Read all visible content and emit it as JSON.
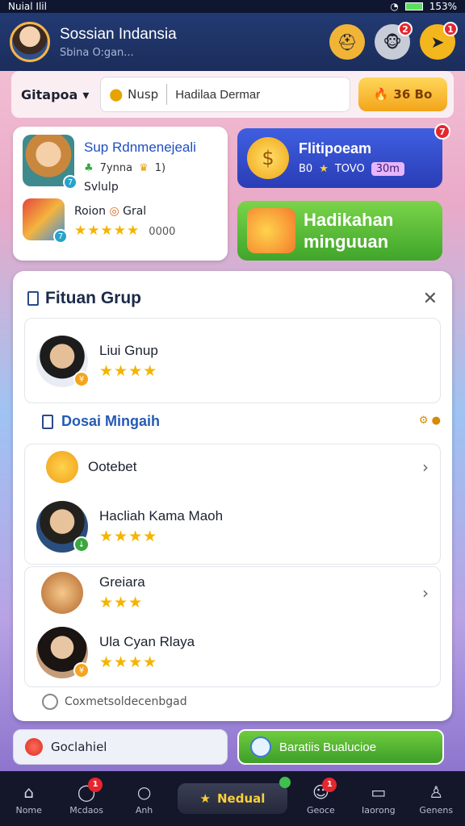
{
  "status": {
    "left": "Nuial Ilil",
    "right": "153%"
  },
  "header": {
    "title": "Sossian Indansia",
    "subtitle": "Sbina O:gan...",
    "badges": [
      "2",
      "1"
    ]
  },
  "search": {
    "dropdown_label": "Gitapoa",
    "prefix": "Nusp",
    "value": "Hadilaa Dermar",
    "coins": "36 Bo"
  },
  "profile_card": {
    "name": "Sup Rdnmenejeali",
    "stat_a": "7ynna",
    "stat_b": "1)",
    "label": "Svlulp",
    "sub_label": "Roion",
    "sub_value": "Gral",
    "rating": "0000",
    "stars": "★★★★★"
  },
  "promo": {
    "title": "Flitipoeam",
    "meta_a": "B0",
    "meta_b": "TOVO",
    "meta_c": "30m",
    "badge": "7"
  },
  "reward": {
    "line1": "Hadikahan",
    "line2": "minguuan"
  },
  "panel": {
    "title": "Fituan Grup",
    "top_member": {
      "name": "Liui Gnup",
      "stars": "★★★★"
    },
    "section_title": "Dosai Mingaih",
    "list": [
      {
        "name": "Ootebet"
      },
      {
        "name": "Hacliah Kama Maoh",
        "stars": "★★★★"
      },
      {
        "name": "Greiara",
        "stars": "★★★"
      },
      {
        "name": "Ula Cyan Rlaya",
        "stars": "★★★★"
      }
    ],
    "footer_note": "Coxmetsoldecenbgad"
  },
  "actions": {
    "left": "Goclahiel",
    "right": "Baratiis Bualucioe"
  },
  "nav": {
    "items": [
      {
        "label": "Nome",
        "icon": "home-icon"
      },
      {
        "label": "Mcdaos",
        "icon": "chat-icon",
        "badge": "1"
      },
      {
        "label": "Anh",
        "icon": "search-icon"
      },
      {
        "label": "Nedual",
        "icon": "star-icon"
      },
      {
        "label": "Geoce",
        "icon": "group-icon",
        "badge": "1"
      },
      {
        "label": "Iaorong",
        "icon": "screen-icon"
      },
      {
        "label": "Genens",
        "icon": "user-icon"
      }
    ]
  }
}
